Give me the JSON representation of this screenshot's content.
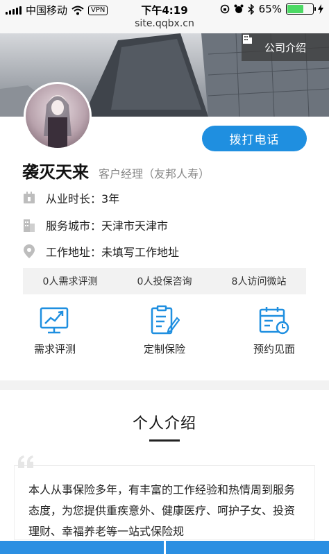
{
  "status_bar": {
    "carrier": "中国移动",
    "vpn": "VPN",
    "time": "下午4:19",
    "battery": "65%",
    "battery_level": 0.65
  },
  "url": "site.qqbx.cn",
  "banner": {
    "company_intro": "公司介绍"
  },
  "profile": {
    "call_button": "拨打电话",
    "name": "袭灭天来",
    "role": "客户经理（友邦人寿）",
    "years": "从业时长：3年",
    "city": "服务城市：天津市天津市",
    "address": "工作地址：未填写工作地址"
  },
  "stats": [
    "0人需求评测",
    "0人投保咨询",
    "8人访问微站"
  ],
  "actions": [
    "需求评测",
    "定制保险",
    "预约见面"
  ],
  "section": {
    "title": "个人介绍",
    "intro": "本人从事保险多年，有丰富的工作经验和热情周到服务态度，为您提供重疾意外、健康医疗、呵护子女、投资理财、幸福养老等一站式保险规"
  },
  "colors": {
    "accent": "#1f8fe0"
  }
}
